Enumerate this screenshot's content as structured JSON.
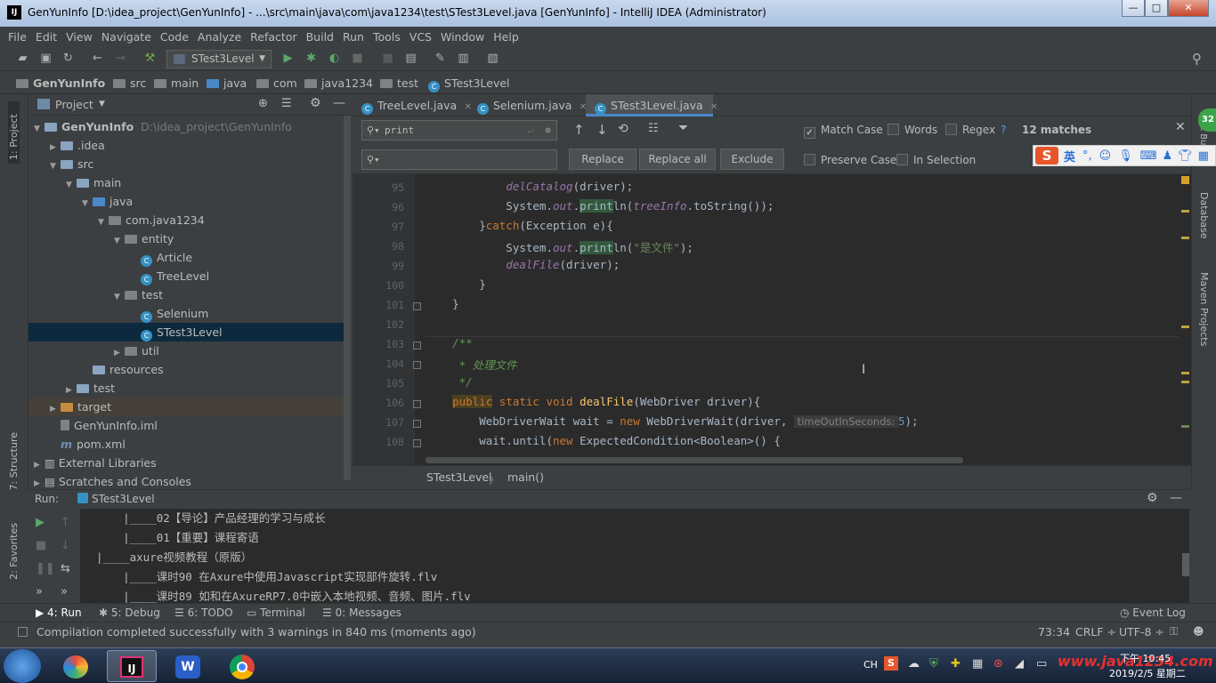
{
  "window": {
    "title": "GenYunInfo [D:\\idea_project\\GenYunInfo] - ...\\src\\main\\java\\com\\java1234\\test\\STest3Level.java [GenYunInfo] - IntelliJ IDEA (Administrator)",
    "ij_logo": "IJ",
    "min": "—",
    "max": "□",
    "close": "✕"
  },
  "menu": [
    "File",
    "Edit",
    "View",
    "Navigate",
    "Code",
    "Analyze",
    "Refactor",
    "Build",
    "Run",
    "Tools",
    "VCS",
    "Window",
    "Help"
  ],
  "toolbar": {
    "run_config": "STest3Level"
  },
  "breadcrumbs": [
    "GenYunInfo",
    "src",
    "main",
    "java",
    "com",
    "java1234",
    "test",
    "STest3Level"
  ],
  "left_strip": {
    "project": "1: Project",
    "structure": "7: Structure",
    "favorites": "2: Favorites"
  },
  "project_panel": {
    "title": "Project",
    "tree": [
      {
        "label": "GenYunInfo",
        "path": "D:\\idea_project\\GenYunInfo",
        "indent": 0,
        "arrow": "▼",
        "icon": "module",
        "bold": true
      },
      {
        "label": ".idea",
        "indent": 1,
        "arrow": "▶",
        "icon": "folder"
      },
      {
        "label": "src",
        "indent": 1,
        "arrow": "▼",
        "icon": "folder"
      },
      {
        "label": "main",
        "indent": 2,
        "arrow": "▼",
        "icon": "folder"
      },
      {
        "label": "java",
        "indent": 3,
        "arrow": "▼",
        "icon": "blue"
      },
      {
        "label": "com.java1234",
        "indent": 4,
        "arrow": "▼",
        "icon": "gray"
      },
      {
        "label": "entity",
        "indent": 5,
        "arrow": "▼",
        "icon": "gray"
      },
      {
        "label": "Article",
        "indent": 6,
        "arrow": "",
        "icon": "class"
      },
      {
        "label": "TreeLevel",
        "indent": 6,
        "arrow": "",
        "icon": "class"
      },
      {
        "label": "test",
        "indent": 5,
        "arrow": "▼",
        "icon": "gray"
      },
      {
        "label": "Selenium",
        "indent": 6,
        "arrow": "",
        "icon": "class"
      },
      {
        "label": "STest3Level",
        "indent": 6,
        "arrow": "",
        "icon": "class",
        "selected": true
      },
      {
        "label": "util",
        "indent": 5,
        "arrow": "▶",
        "icon": "gray"
      },
      {
        "label": "resources",
        "indent": 3,
        "arrow": "",
        "icon": "folder"
      },
      {
        "label": "test",
        "indent": 2,
        "arrow": "▶",
        "icon": "folder"
      },
      {
        "label": "target",
        "indent": 1,
        "arrow": "▶",
        "icon": "orange"
      },
      {
        "label": "GenYunInfo.iml",
        "indent": 1,
        "arrow": "",
        "icon": "file"
      },
      {
        "label": "pom.xml",
        "indent": 1,
        "arrow": "",
        "icon": "maven"
      },
      {
        "label": "External Libraries",
        "indent": 0,
        "arrow": "▶",
        "icon": "lib"
      },
      {
        "label": "Scratches and Consoles",
        "indent": 0,
        "arrow": "▶",
        "icon": "scratch"
      }
    ]
  },
  "editor_tabs": [
    {
      "label": "TreeLevel.java",
      "active": false
    },
    {
      "label": "Selenium.java",
      "active": false
    },
    {
      "label": "STest3Level.java",
      "active": true
    }
  ],
  "find": {
    "query": "print",
    "match_case": "Match Case",
    "words": "Words",
    "regex": "Regex",
    "help": "?",
    "matches": "12 matches",
    "replace_btn": "Replace",
    "replace_all_btn": "Replace all",
    "exclude_btn": "Exclude",
    "preserve_case": "Preserve Case",
    "in_selection": "In Selection"
  },
  "code": {
    "lines": [
      {
        "n": "95",
        "html": "            <span class='it'>delCatalog</span>(driver);"
      },
      {
        "n": "96",
        "html": "            System.<span class='it'>out</span>.<span class='hl'>print</span>ln(<span class='it'>treeInfo</span>.toString());"
      },
      {
        "n": "97",
        "html": "        }<span class='kw'>catch</span>(Exception e){"
      },
      {
        "n": "98",
        "html": "            System.<span class='it'>out</span>.<span class='hl'>print</span>ln(<span class='str'>\"是文件\"</span>);"
      },
      {
        "n": "99",
        "html": "            <span class='it'>dealFile</span>(driver);"
      },
      {
        "n": "100",
        "html": "        }"
      },
      {
        "n": "101",
        "html": "    }"
      },
      {
        "n": "102",
        "html": ""
      },
      {
        "n": "103",
        "html": "    <span class='cm'>/**</span>"
      },
      {
        "n": "104",
        "html": "<span class='cm'>     * 处理文件</span>"
      },
      {
        "n": "105",
        "html": "<span class='cm'>     */</span>"
      },
      {
        "n": "106",
        "html": "    <span class='kw' style='background:#4a4020'>public</span> <span class='kw'>static void</span> <span class='fn'>dealFile</span>(WebDriver driver){"
      },
      {
        "n": "107",
        "html": "        WebDriverWait wait = <span class='kw'>new</span> WebDriverWait(driver, <span style='background:#3b3b3b;color:#808080;font-family:DejaVu Sans,sans-serif;font-size:11.5px'> timeOutInSeconds: </span><span style='color:#6897bb'>5</span>);"
      },
      {
        "n": "108",
        "html": "        wait.until(<span class='kw'>new</span> ExpectedCondition&lt;Boolean&gt;() {"
      }
    ],
    "hint": "timeOutInSeconds:"
  },
  "editor_breadcrumb": [
    "STest3Level",
    "main()"
  ],
  "right_strip": {
    "ant": "Ant Build",
    "database": "Database",
    "maven": "Maven Projects"
  },
  "run": {
    "label": "Run:",
    "config": "STest3Level",
    "output": [
      "    |____02【导论】产品经理的学习与成长",
      "    |____01【重要】课程寄语",
      "|____axure视频教程（原版）",
      "    |____课时90 在Axure中使用Javascript实现部件旋转.flv",
      "    |____课时89 如和在AxureRP7.0中嵌入本地视频、音频、图片.flv"
    ]
  },
  "bottom_tabs": [
    "4: Run",
    "5: Debug",
    "6: TODO",
    "Terminal",
    "0: Messages"
  ],
  "event_log": "Event Log",
  "status": {
    "message": "Compilation completed successfully with 3 warnings in 840 ms (moments ago)",
    "position": "73:34",
    "line_sep": "CRLF ÷",
    "encoding": "UTF-8 ÷"
  },
  "taskbar": {
    "lang": "CH",
    "time": "下午 10:45",
    "date": "2019/2/5 星期二",
    "watermark": "www.java1234.com"
  },
  "ime": {
    "label": "英"
  },
  "badge": "32"
}
